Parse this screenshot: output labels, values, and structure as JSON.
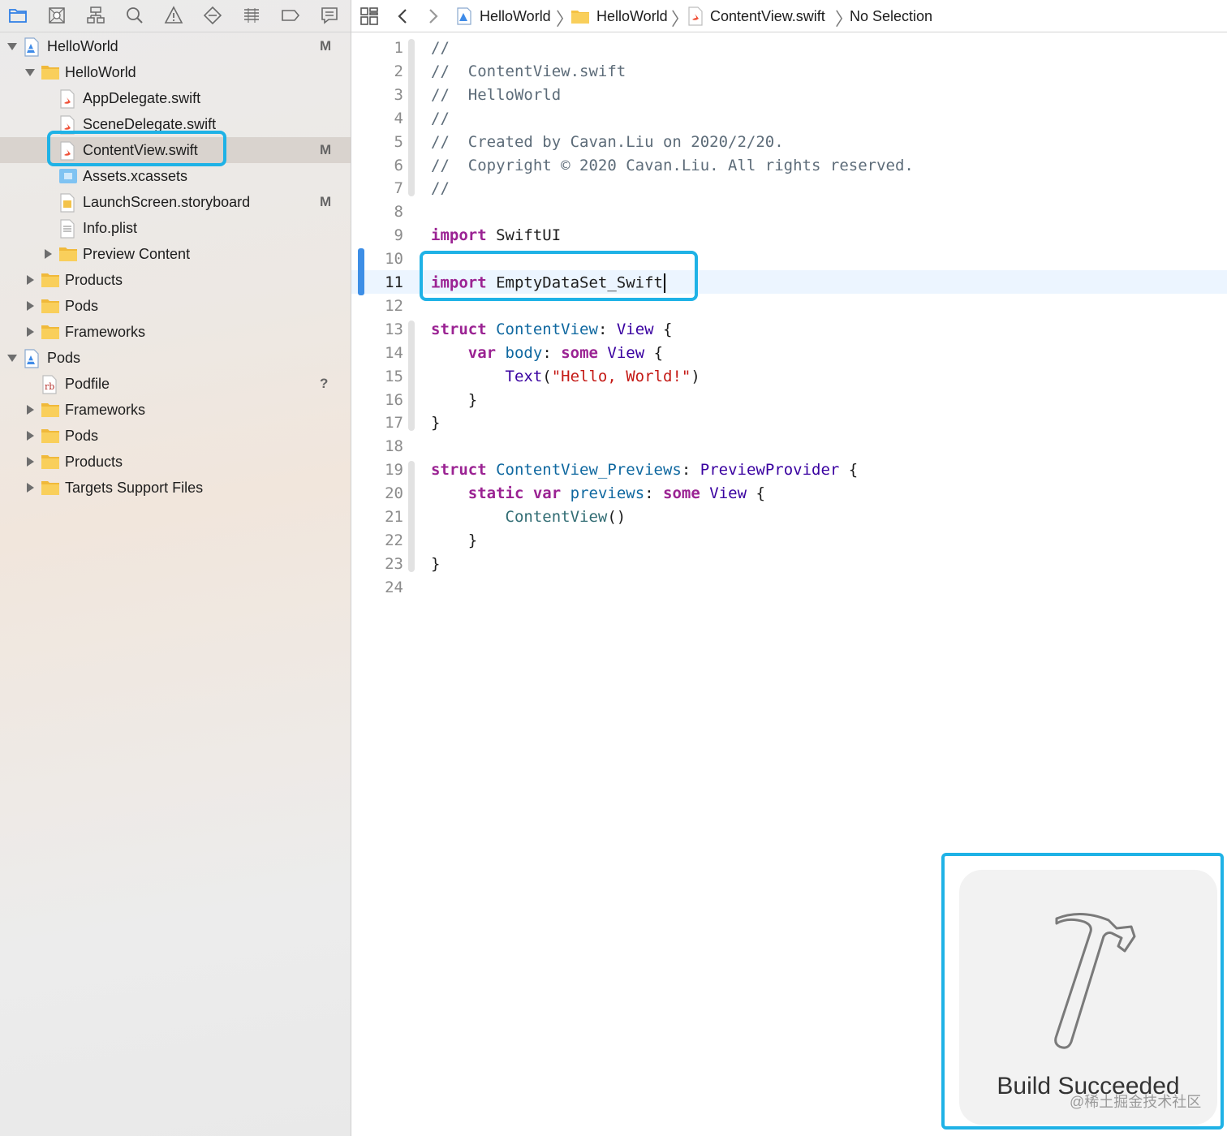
{
  "navigator": {
    "toolbar_icons": [
      "folder-icon",
      "source-control-icon",
      "hierarchy-icon",
      "search-icon",
      "warning-icon",
      "test-diamond-icon",
      "debug-icon",
      "breakpoint-icon",
      "report-icon"
    ],
    "items": [
      {
        "label": "HelloWorld",
        "badge": "M",
        "icon": "xcode-project-icon",
        "disclosure": "open"
      },
      {
        "label": "HelloWorld",
        "badge": "",
        "icon": "folder-icon",
        "disclosure": "open"
      },
      {
        "label": "AppDelegate.swift",
        "badge": "",
        "icon": "swift-file-icon",
        "disclosure": ""
      },
      {
        "label": "SceneDelegate.swift",
        "badge": "",
        "icon": "swift-file-icon",
        "disclosure": ""
      },
      {
        "label": "ContentView.swift",
        "badge": "M",
        "icon": "swift-file-icon",
        "disclosure": ""
      },
      {
        "label": "Assets.xcassets",
        "badge": "",
        "icon": "asset-catalog-icon",
        "disclosure": ""
      },
      {
        "label": "LaunchScreen.storyboard",
        "badge": "M",
        "icon": "storyboard-icon",
        "disclosure": ""
      },
      {
        "label": "Info.plist",
        "badge": "",
        "icon": "plist-icon",
        "disclosure": ""
      },
      {
        "label": "Preview Content",
        "badge": "",
        "icon": "folder-icon",
        "disclosure": "closed"
      },
      {
        "label": "Products",
        "badge": "",
        "icon": "folder-icon",
        "disclosure": "closed"
      },
      {
        "label": "Pods",
        "badge": "",
        "icon": "folder-icon",
        "disclosure": "closed"
      },
      {
        "label": "Frameworks",
        "badge": "",
        "icon": "folder-icon",
        "disclosure": "closed"
      },
      {
        "label": "Pods",
        "badge": "",
        "icon": "xcode-project-icon",
        "disclosure": "open"
      },
      {
        "label": "Podfile",
        "badge": "?",
        "icon": "ruby-file-icon",
        "disclosure": ""
      },
      {
        "label": "Frameworks",
        "badge": "",
        "icon": "folder-icon",
        "disclosure": "closed"
      },
      {
        "label": "Pods",
        "badge": "",
        "icon": "folder-icon",
        "disclosure": "closed"
      },
      {
        "label": "Products",
        "badge": "",
        "icon": "folder-icon",
        "disclosure": "closed"
      },
      {
        "label": "Targets Support Files",
        "badge": "",
        "icon": "folder-icon",
        "disclosure": "closed"
      }
    ]
  },
  "jumpbar": {
    "items": [
      "HelloWorld",
      "HelloWorld",
      "ContentView.swift",
      "No Selection"
    ],
    "separator": "〉"
  },
  "editor": {
    "current_line": 11,
    "lines": [
      [
        {
          "t": "comment",
          "s": "//"
        }
      ],
      [
        {
          "t": "comment",
          "s": "//  ContentView.swift"
        }
      ],
      [
        {
          "t": "comment",
          "s": "//  HelloWorld"
        }
      ],
      [
        {
          "t": "comment",
          "s": "//"
        }
      ],
      [
        {
          "t": "comment",
          "s": "//  Created by Cavan.Liu on 2020/2/20."
        }
      ],
      [
        {
          "t": "comment",
          "s": "//  Copyright © 2020 Cavan.Liu. All rights reserved."
        }
      ],
      [
        {
          "t": "comment",
          "s": "//"
        }
      ],
      [],
      [
        {
          "t": "keyword",
          "s": "import"
        },
        {
          "t": "plain",
          "s": " SwiftUI"
        }
      ],
      [],
      [
        {
          "t": "keyword",
          "s": "import"
        },
        {
          "t": "plain",
          "s": " EmptyDataSet_Swift"
        }
      ],
      [],
      [
        {
          "t": "keyword",
          "s": "struct"
        },
        {
          "t": "plain",
          "s": " "
        },
        {
          "t": "project",
          "s": "ContentView"
        },
        {
          "t": "plain",
          "s": ": "
        },
        {
          "t": "type",
          "s": "View"
        },
        {
          "t": "plain",
          "s": " {"
        }
      ],
      [
        {
          "t": "plain",
          "s": "    "
        },
        {
          "t": "keyword",
          "s": "var"
        },
        {
          "t": "plain",
          "s": " "
        },
        {
          "t": "project",
          "s": "body"
        },
        {
          "t": "plain",
          "s": ": "
        },
        {
          "t": "keyword",
          "s": "some"
        },
        {
          "t": "plain",
          "s": " "
        },
        {
          "t": "type",
          "s": "View"
        },
        {
          "t": "plain",
          "s": " {"
        }
      ],
      [
        {
          "t": "plain",
          "s": "        "
        },
        {
          "t": "type",
          "s": "Text"
        },
        {
          "t": "plain",
          "s": "("
        },
        {
          "t": "string",
          "s": "\"Hello, World!\""
        },
        {
          "t": "plain",
          "s": ")"
        }
      ],
      [
        {
          "t": "plain",
          "s": "    }"
        }
      ],
      [
        {
          "t": "plain",
          "s": "}"
        }
      ],
      [],
      [
        {
          "t": "keyword",
          "s": "struct"
        },
        {
          "t": "plain",
          "s": " "
        },
        {
          "t": "project",
          "s": "ContentView_Previews"
        },
        {
          "t": "plain",
          "s": ": "
        },
        {
          "t": "type",
          "s": "PreviewProvider"
        },
        {
          "t": "plain",
          "s": " {"
        }
      ],
      [
        {
          "t": "plain",
          "s": "    "
        },
        {
          "t": "keyword",
          "s": "static"
        },
        {
          "t": "plain",
          "s": " "
        },
        {
          "t": "keyword",
          "s": "var"
        },
        {
          "t": "plain",
          "s": " "
        },
        {
          "t": "project",
          "s": "previews"
        },
        {
          "t": "plain",
          "s": ": "
        },
        {
          "t": "keyword",
          "s": "some"
        },
        {
          "t": "plain",
          "s": " "
        },
        {
          "t": "type",
          "s": "View"
        },
        {
          "t": "plain",
          "s": " {"
        }
      ],
      [
        {
          "t": "plain",
          "s": "        "
        },
        {
          "t": "call",
          "s": "ContentView"
        },
        {
          "t": "plain",
          "s": "()"
        }
      ],
      [
        {
          "t": "plain",
          "s": "    }"
        }
      ],
      [
        {
          "t": "plain",
          "s": "}"
        }
      ],
      []
    ]
  },
  "hud": {
    "title": "Build Succeeded",
    "icon": "hammer-icon"
  },
  "watermark": "@稀土掘金技术社区",
  "colors": {
    "accent": "#1fb2e6",
    "keyword": "#9b2393",
    "type": "#3900a0",
    "project": "#0f68a0",
    "string": "#c41a16",
    "comment": "#5d6c79",
    "folder": "#f5c243",
    "selection": "#d9d3ce"
  }
}
